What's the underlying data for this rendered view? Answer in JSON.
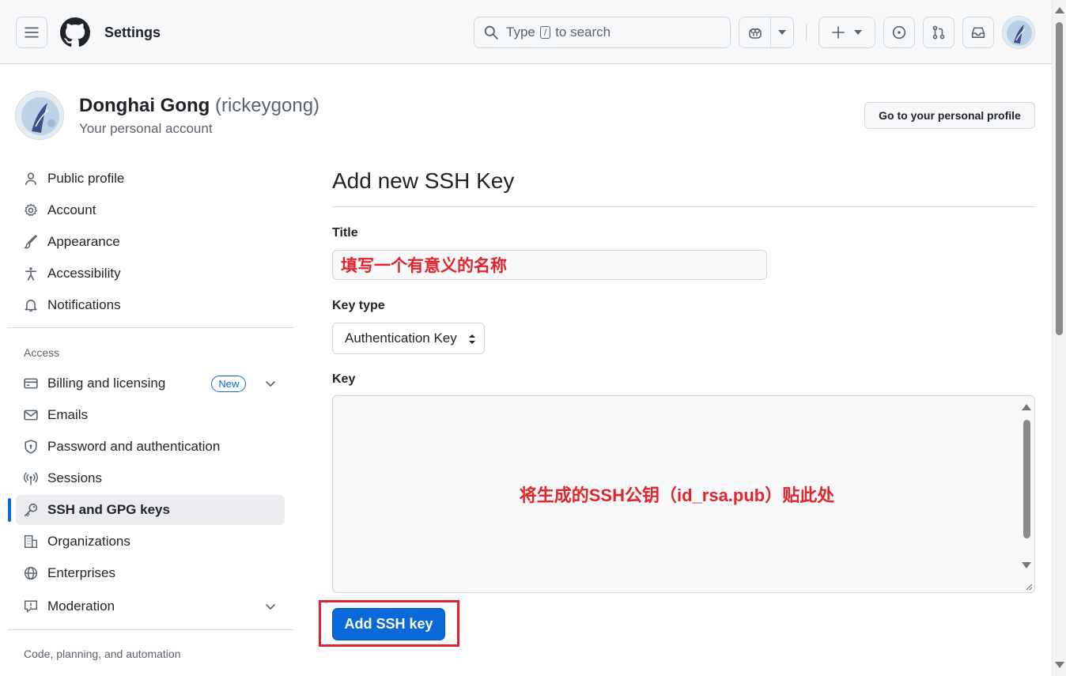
{
  "header": {
    "title": "Settings",
    "search": {
      "prefix": "Type",
      "key": "/",
      "suffix": "to search"
    },
    "icons": [
      "hamburger-icon",
      "github-logo",
      "search-icon",
      "copilot-icon",
      "plus-icon",
      "issues-icon",
      "pull-request-icon",
      "inbox-icon"
    ]
  },
  "account": {
    "name": "Donghai Gong",
    "login": "(rickeygong)",
    "subtitle": "Your personal account",
    "profile_button": "Go to your personal profile"
  },
  "sidebar": {
    "items": [
      {
        "label": "Public profile",
        "icon": "person-icon"
      },
      {
        "label": "Account",
        "icon": "gear-icon"
      },
      {
        "label": "Appearance",
        "icon": "paintbrush-icon"
      },
      {
        "label": "Accessibility",
        "icon": "accessibility-icon"
      },
      {
        "label": "Notifications",
        "icon": "bell-icon"
      }
    ],
    "access_heading": "Access",
    "access_items": [
      {
        "label": "Billing and licensing",
        "icon": "credit-card-icon",
        "badge": "New"
      },
      {
        "label": "Emails",
        "icon": "mail-icon"
      },
      {
        "label": "Password and authentication",
        "icon": "shield-icon"
      },
      {
        "label": "Sessions",
        "icon": "broadcast-icon"
      },
      {
        "label": "SSH and GPG keys",
        "icon": "key-icon"
      },
      {
        "label": "Organizations",
        "icon": "organization-icon"
      },
      {
        "label": "Enterprises",
        "icon": "globe-icon"
      },
      {
        "label": "Moderation",
        "icon": "report-icon"
      }
    ],
    "code_heading": "Code, planning, and automation"
  },
  "main": {
    "title": "Add new SSH Key",
    "title_label": "Title",
    "title_value": "填写一个有意义的名称",
    "key_type_label": "Key type",
    "key_type_value": "Authentication Key",
    "key_label": "Key",
    "key_annotation": "将生成的SSH公钥（id_rsa.pub）贴此处",
    "submit": "Add SSH key"
  },
  "colors": {
    "accent": "#0969da",
    "annotation": "#e3242b"
  }
}
